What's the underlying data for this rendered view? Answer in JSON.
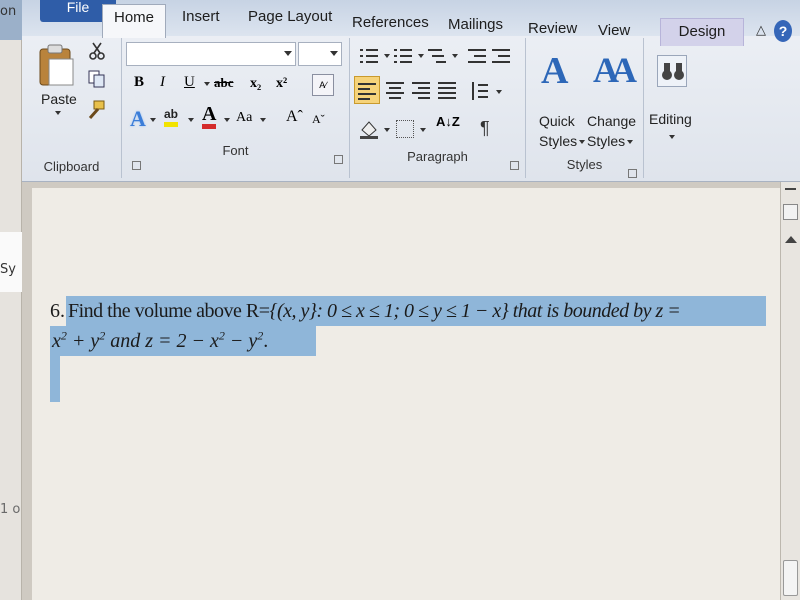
{
  "background_window": {
    "top_text": "on",
    "mid_text": "Sy",
    "bottom_text": "1 o"
  },
  "ribbon": {
    "tabs": {
      "file": "File",
      "home": "Home",
      "insert": "Insert",
      "page_layout": "Page Layout",
      "references": "References",
      "mailings": "Mailings",
      "review": "Review",
      "view": "View",
      "design": "Design"
    },
    "clipboard": {
      "paste_label": "Paste",
      "group_label": "Clipboard"
    },
    "font": {
      "font_name_value": "",
      "font_size_value": "",
      "bold": "B",
      "italic": "I",
      "underline": "U",
      "strikethrough": "abc",
      "subscript": "x₂",
      "superscript": "x²",
      "font_color_letter": "A",
      "change_case": "Aa",
      "grow_font": "Aˆ",
      "shrink_font": "Aˇ",
      "text_effects_letter": "A",
      "highlight_label": "ab",
      "group_label": "Font"
    },
    "paragraph": {
      "sort": "A↓Z",
      "show_marks": "¶",
      "group_label": "Paragraph"
    },
    "styles": {
      "quick_styles_line1": "Quick",
      "quick_styles_line2": "Styles",
      "change_styles_line1": "Change",
      "change_styles_line2": "Styles",
      "group_label": "Styles"
    },
    "editing": {
      "label": "Editing"
    },
    "accent_color": "#2f5da8",
    "design_tab_color": "#d3d2ea"
  },
  "document": {
    "question_number": "6.",
    "line1_plain": "Find the volume above R=",
    "line1_math": "{(x, y}: 0 ≤ x ≤ 1; 0 ≤ y ≤ 1 − x}",
    "line1_tail": " that is bounded by z =",
    "line2_part1": "x",
    "line2_part2": " + y",
    "line2_part3": " and z = 2 − x",
    "line2_part4": " − y",
    "line2_end": ".",
    "exponent": "2",
    "highlight_color": "#8fb6d9"
  }
}
